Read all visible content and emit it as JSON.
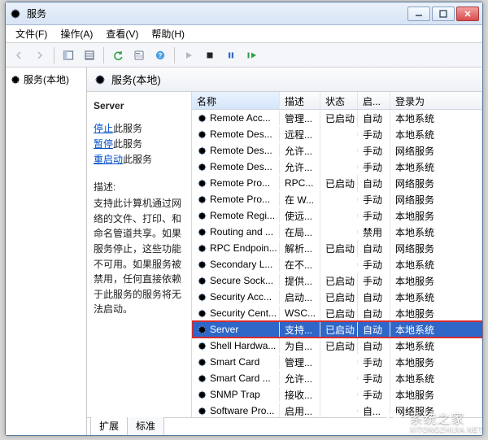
{
  "window": {
    "title": "服务"
  },
  "menubar": {
    "file": "文件(F)",
    "action": "操作(A)",
    "view": "查看(V)",
    "help": "帮助(H)"
  },
  "tree": {
    "root": "服务(本地)"
  },
  "content_header": "服务(本地)",
  "detail": {
    "title": "Server",
    "stop_prefix": "停止",
    "pause_prefix": "暂停",
    "restart_prefix": "重启动",
    "action_suffix": "此服务",
    "desc_label": "描述:",
    "desc_text": "支持此计算机通过网络的文件、打印、和命名管道共享。如果服务停止，这些功能不可用。如果服务被禁用，任何直接依赖于此服务的服务将无法启动。"
  },
  "columns": {
    "name": "名称",
    "desc": "描述",
    "status": "状态",
    "startup": "启...",
    "logon": "登录为"
  },
  "tabs": {
    "extended": "扩展",
    "standard": "标准"
  },
  "selected_index": 13,
  "services": [
    {
      "name": "Remote Acc...",
      "desc": "管理...",
      "status": "已启动",
      "startup": "自动",
      "logon": "本地系统"
    },
    {
      "name": "Remote Des...",
      "desc": "远程...",
      "status": "",
      "startup": "手动",
      "logon": "本地系统"
    },
    {
      "name": "Remote Des...",
      "desc": "允许...",
      "status": "",
      "startup": "手动",
      "logon": "网络服务"
    },
    {
      "name": "Remote Des...",
      "desc": "允许...",
      "status": "",
      "startup": "手动",
      "logon": "本地系统"
    },
    {
      "name": "Remote Pro...",
      "desc": "RPC...",
      "status": "已启动",
      "startup": "自动",
      "logon": "网络服务"
    },
    {
      "name": "Remote Pro...",
      "desc": "在 W...",
      "status": "",
      "startup": "手动",
      "logon": "网络服务"
    },
    {
      "name": "Remote Regi...",
      "desc": "使远...",
      "status": "",
      "startup": "手动",
      "logon": "本地服务"
    },
    {
      "name": "Routing and ...",
      "desc": "在局...",
      "status": "",
      "startup": "禁用",
      "logon": "本地系统"
    },
    {
      "name": "RPC Endpoin...",
      "desc": "解析...",
      "status": "已启动",
      "startup": "自动",
      "logon": "网络服务"
    },
    {
      "name": "Secondary L...",
      "desc": "在不...",
      "status": "",
      "startup": "手动",
      "logon": "本地系统"
    },
    {
      "name": "Secure Sock...",
      "desc": "提供...",
      "status": "已启动",
      "startup": "手动",
      "logon": "本地服务"
    },
    {
      "name": "Security Acc...",
      "desc": "启动...",
      "status": "已启动",
      "startup": "自动",
      "logon": "本地系统"
    },
    {
      "name": "Security Cent...",
      "desc": "WSC...",
      "status": "已启动",
      "startup": "自动",
      "logon": "本地服务"
    },
    {
      "name": "Server",
      "desc": "支持...",
      "status": "已启动",
      "startup": "自动",
      "logon": "本地系统"
    },
    {
      "name": "Shell Hardwa...",
      "desc": "为自...",
      "status": "已启动",
      "startup": "自动",
      "logon": "本地系统"
    },
    {
      "name": "Smart Card",
      "desc": "管理...",
      "status": "",
      "startup": "手动",
      "logon": "本地服务"
    },
    {
      "name": "Smart Card ...",
      "desc": "允许...",
      "status": "",
      "startup": "手动",
      "logon": "本地系统"
    },
    {
      "name": "SNMP Trap",
      "desc": "接收...",
      "status": "",
      "startup": "手动",
      "logon": "本地服务"
    },
    {
      "name": "Software Pro...",
      "desc": "启用...",
      "status": "",
      "startup": "自...",
      "logon": "网络服务"
    }
  ],
  "watermark": {
    "cn": "系统之家",
    "en": "XITONGZHIJIA.NET"
  }
}
